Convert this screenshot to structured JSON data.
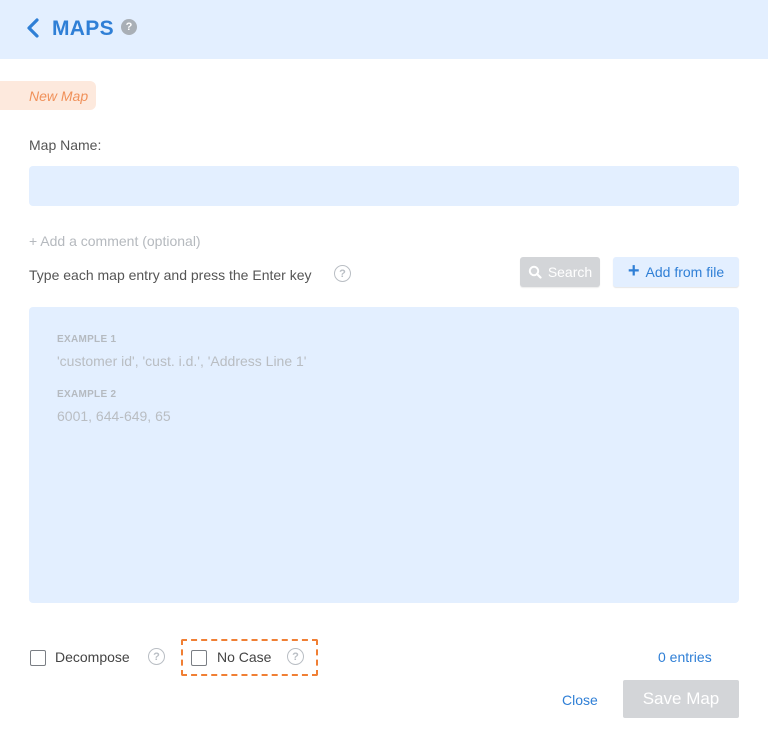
{
  "header": {
    "title": "MAPS",
    "help_icon": "question-circle-icon",
    "back_icon": "chevron-left-icon"
  },
  "tag": {
    "label": "New Map"
  },
  "form": {
    "map_name_label": "Map Name:",
    "map_name_value": "",
    "add_comment": "+ Add a comment (optional)",
    "instruction": "Type each map entry and press the Enter key"
  },
  "buttons": {
    "search": "Search",
    "add_from_file": "Add from file",
    "close": "Close",
    "save": "Save Map"
  },
  "entries": {
    "examples": [
      {
        "label": "EXAMPLE 1",
        "text": "'customer id', 'cust. i.d.', 'Address Line 1'"
      },
      {
        "label": "EXAMPLE 2",
        "text": "6001, 644-649, 65"
      }
    ],
    "count": "0 entries"
  },
  "options": {
    "decompose": {
      "label": "Decompose",
      "checked": false
    },
    "no_case": {
      "label": "No Case",
      "checked": false
    }
  },
  "colors": {
    "accent": "#2f7fd6",
    "panel": "#e3efff",
    "tag_bg": "#fde9dd",
    "tag_text": "#f0915a",
    "highlight": "#f07f34",
    "disabled": "#d3d5d8"
  }
}
